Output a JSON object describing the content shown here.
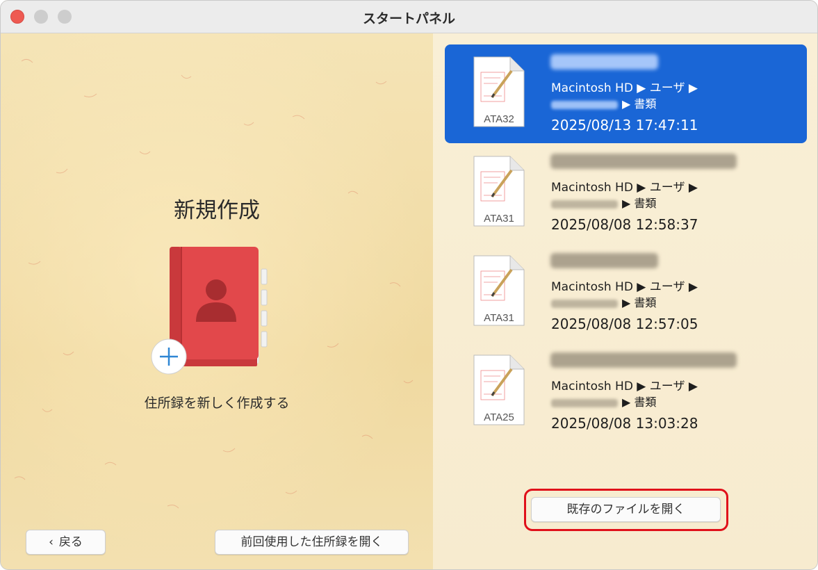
{
  "window": {
    "title": "スタートパネル"
  },
  "left": {
    "heading": "新規作成",
    "create_label": "住所録を新しく作成する",
    "back_button": "戻る",
    "open_previous_button": "前回使用した住所録を開く"
  },
  "recent_files": [
    {
      "icon_label": "ATA32",
      "path_line1": "Macintosh HD ▶ ユーザ ▶",
      "path_line2": "▶ 書類",
      "date": "2025/08/13 17:47:11",
      "selected": true
    },
    {
      "icon_label": "ATA31",
      "path_line1": "Macintosh HD ▶ ユーザ ▶",
      "path_line2": "▶ 書類",
      "date": "2025/08/08 12:58:37",
      "selected": false
    },
    {
      "icon_label": "ATA31",
      "path_line1": "Macintosh HD ▶ ユーザ ▶",
      "path_line2": "▶ 書類",
      "date": "2025/08/08 12:57:05",
      "selected": false
    },
    {
      "icon_label": "ATA25",
      "path_line1": "Macintosh HD ▶ ユーザ ▶",
      "path_line2": "▶ 書類",
      "date": "2025/08/08 13:03:28",
      "selected": false
    }
  ],
  "right": {
    "open_existing_button": "既存のファイルを開く"
  },
  "colors": {
    "selection": "#1a66d6",
    "highlight_box": "#e0101a",
    "book_cover": "#e2484b"
  }
}
